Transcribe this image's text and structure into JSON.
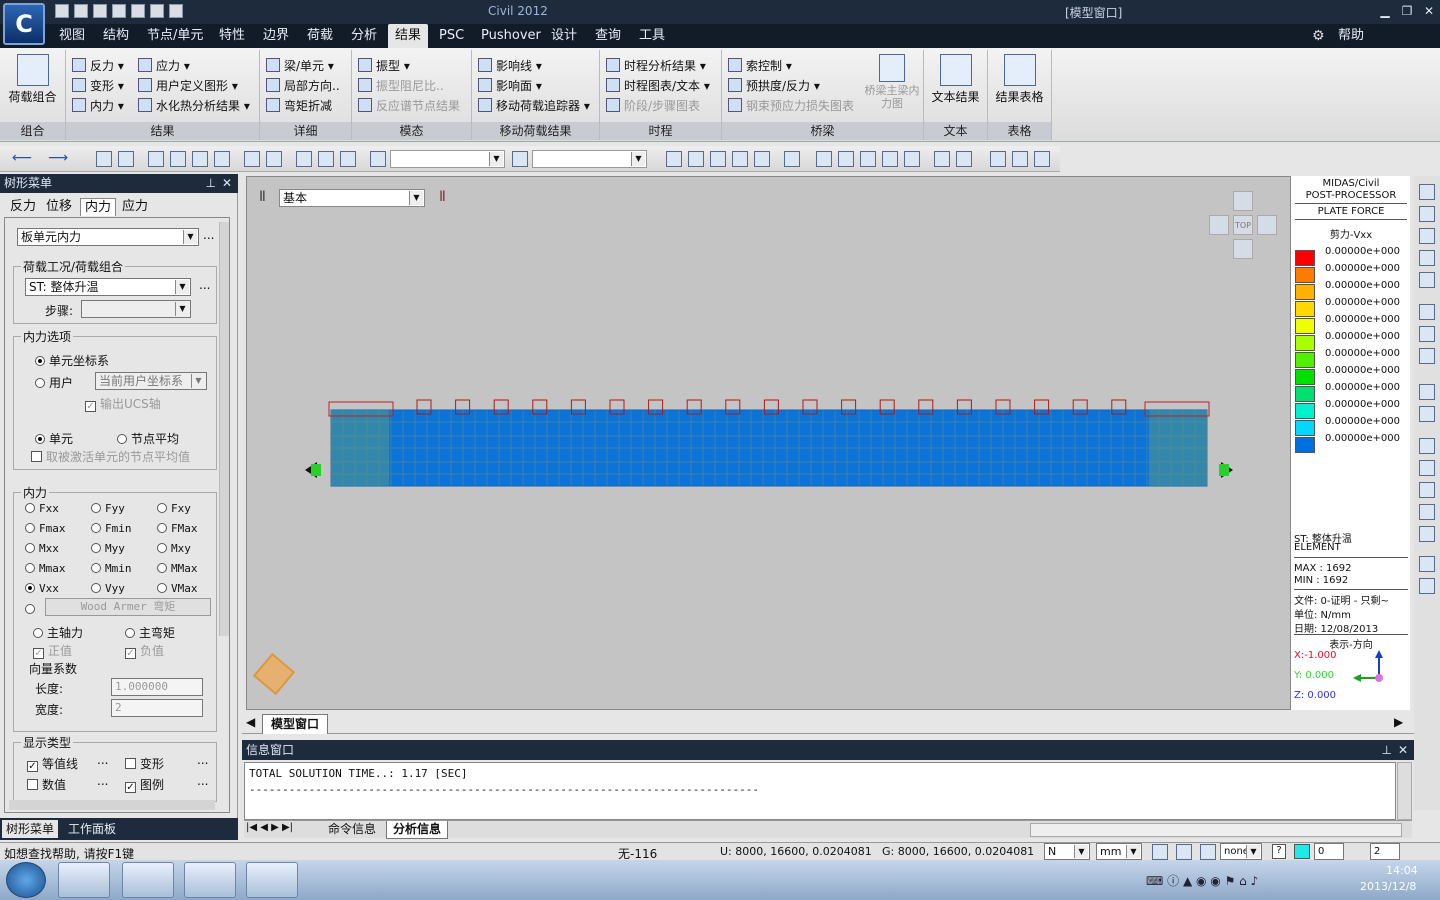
{
  "app": {
    "title": "Civil 2012",
    "window": "[模型窗口]",
    "logo": "C"
  },
  "menu": {
    "tabs": [
      "视图",
      "结构",
      "节点/单元",
      "特性",
      "边界",
      "荷载",
      "分析",
      "结果",
      "PSC",
      "Pushover",
      "设计",
      "查询",
      "工具"
    ],
    "active": "结果",
    "help": "帮助"
  },
  "ribbon": {
    "combo": {
      "label": "荷载组合",
      "group": "组合"
    },
    "results": {
      "items": [
        "反力",
        "变形",
        "内力",
        "应力",
        "用户定义图形",
        "水化热分析结果"
      ],
      "group": "结果"
    },
    "detail": {
      "items": [
        "梁/单元",
        "局部方向..",
        "弯矩折减"
      ],
      "group": "详细"
    },
    "mode": {
      "items": [
        "振型",
        "振型阻尼比..",
        "反应谱节点结果"
      ],
      "group": "模态"
    },
    "moving": {
      "items": [
        "影响线",
        "影响面",
        "移动荷载追踪器"
      ],
      "group": "移动荷载结果"
    },
    "time": {
      "items": [
        "时程分析结果",
        "时程图表/文本",
        "阶段/步骤图表"
      ],
      "group": "时程"
    },
    "bridge": {
      "items": [
        "索控制",
        "预拱度/反力",
        "钢束预应力损失图表"
      ],
      "big": "桥梁主梁内力图",
      "group": "桥梁"
    },
    "text": {
      "label": "文本结果",
      "group": "文本"
    },
    "table": {
      "label": "结果表格",
      "group": "表格"
    }
  },
  "sidebar": {
    "title": "树形菜单",
    "tabs": [
      "反力",
      "位移",
      "内力",
      "应力"
    ],
    "active_tab": "内力",
    "type_select": "板单元内力",
    "load_group_title": "荷载工况/荷载组合",
    "load_case": "ST: 整体升温",
    "step_label": "步骤:",
    "force_opts_title": "内力选项",
    "elem_cs": "单元坐标系",
    "user": "用户",
    "user_cs": "当前用户坐标系",
    "output_ucs": "输出UCS轴",
    "elem": "单元",
    "node_avg": "节点平均",
    "cancel_avg": "取被激活单元的节点平均值",
    "force_title": "内力",
    "forces": [
      "Fxx",
      "Fyy",
      "Fxy",
      "Fmax",
      "Fmin",
      "FMax",
      "Mxx",
      "Myy",
      "Mxy",
      "Mmax",
      "Mmin",
      "MMax",
      "Vxx",
      "Vyy",
      "VMax"
    ],
    "selected_force": "Vxx",
    "wood_armer": "Wood Armer 弯矩",
    "main_axial": "主轴力",
    "main_moment": "主弯矩",
    "positive": "正值",
    "negative": "负值",
    "vec_title": "向量系数",
    "length_label": "长度:",
    "length_val": "1.000000",
    "width_label": "宽度:",
    "width_val": "2",
    "display_title": "显示类型",
    "contour": "等值线",
    "deform": "变形",
    "values": "数值",
    "legend": "图例",
    "bottom_tabs": [
      "树形菜单",
      "工作面板"
    ]
  },
  "view": {
    "combo": "基本",
    "tab": "模型窗口",
    "top": "TOP"
  },
  "legend": {
    "line1": "MIDAS/Civil",
    "line2": "POST-PROCESSOR",
    "line3": "PLATE FORCE",
    "component": "剪力-Vxx",
    "values": [
      "0.00000e+000",
      "0.00000e+000",
      "0.00000e+000",
      "0.00000e+000",
      "0.00000e+000",
      "0.00000e+000",
      "0.00000e+000",
      "0.00000e+000",
      "0.00000e+000",
      "0.00000e+000",
      "0.00000e+000",
      "0.00000e+000"
    ],
    "colors": [
      "#ff0000",
      "#ff7a00",
      "#ffb000",
      "#ffd800",
      "#f0ff00",
      "#a8ff00",
      "#50f000",
      "#00e000",
      "#00e070",
      "#00f0d0",
      "#00d8ff",
      "#0070e0"
    ],
    "case": "ST: 整体升温",
    "elem": "ELEMENT",
    "max": "MAX : 1692",
    "min": "MIN : 1692",
    "file": "文件: 0-证明 - 只剩~",
    "unit": "单位: N/mm",
    "date": "日期: 12/08/2013",
    "dir": "表示-方向",
    "x": "X:-1.000",
    "y": "Y: 0.000",
    "z": "Z: 0.000"
  },
  "msg": {
    "title": "信息窗口",
    "line1": "TOTAL SOLUTION TIME..:      1.17 [SEC]",
    "line2": "-----------------------------------------------------------------------------",
    "tabs": [
      "命令信息",
      "分析信息"
    ]
  },
  "status": {
    "help": "如想查找帮助, 请按F1键",
    "sel": "无-116",
    "u": "U: 8000, 16600, 0.0204081",
    "g": "G: 8000, 16600, 0.0204081",
    "force_unit": "N",
    "len_unit": "mm",
    "none": "none",
    "p1": "0",
    "p2": "2"
  },
  "taskbar": {
    "time": "14:04",
    "date": "2013/12/8"
  }
}
